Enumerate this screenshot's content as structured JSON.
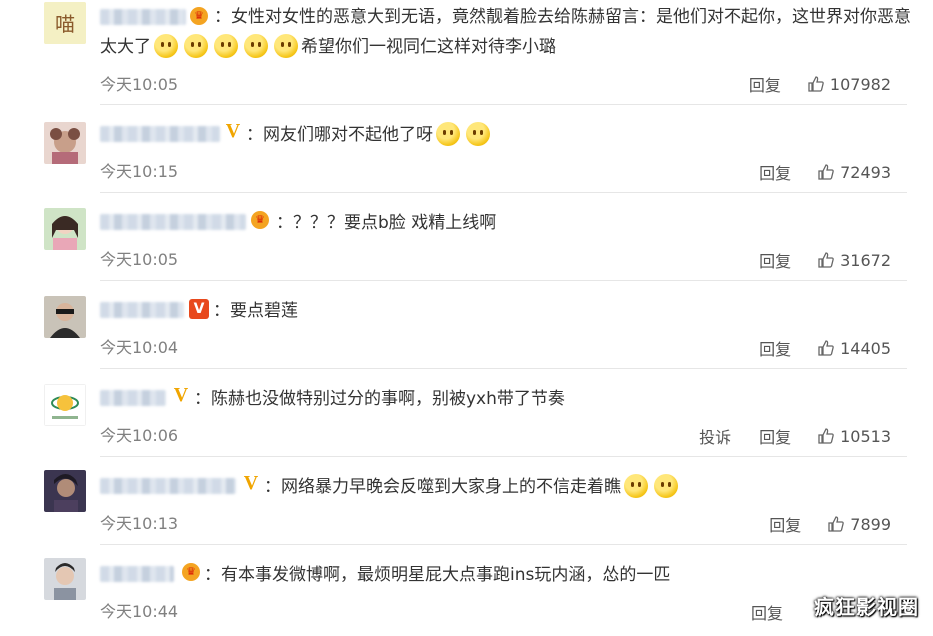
{
  "actions": {
    "reply": "回复",
    "report": "投诉"
  },
  "comments": [
    {
      "line1": "女性对女性的恶意大到无语，竟然靓着脸去给陈赫留言：是他们对不起你，这世界对你恶意",
      "line2a": "太大了",
      "line2b": "希望你们一视同仁这样对待李小璐",
      "time": "今天10:05",
      "likes": "107982"
    },
    {
      "text": "网友们哪对不起他了呀",
      "time": "今天10:15",
      "likes": "72493"
    },
    {
      "text": "？？？要点b脸 戏精上线啊",
      "time": "今天10:05",
      "likes": "31672"
    },
    {
      "text": "要点碧莲",
      "time": "今天10:04",
      "likes": "14405"
    },
    {
      "text": "陈赫也没做特别过分的事啊，别被yxh带了节奏",
      "time": "今天10:06",
      "likes": "10513"
    },
    {
      "text": "网络暴力早晚会反噬到大家身上的不信走着瞧",
      "time": "今天10:13",
      "likes": "7899"
    },
    {
      "text": "有本事发微博啊，最烦明星屁大点事跑ins玩内涵，怂的一匹",
      "time": "今天10:44",
      "likes": ""
    }
  ],
  "avatar_text": {
    "first": "喵"
  },
  "watermark": "疯狂影视圈",
  "colors": {
    "text": "#333333",
    "muted": "#808080",
    "separator": "#e6e6e6",
    "badge_gold": "#f0a500",
    "badge_red": "#e8491d"
  }
}
